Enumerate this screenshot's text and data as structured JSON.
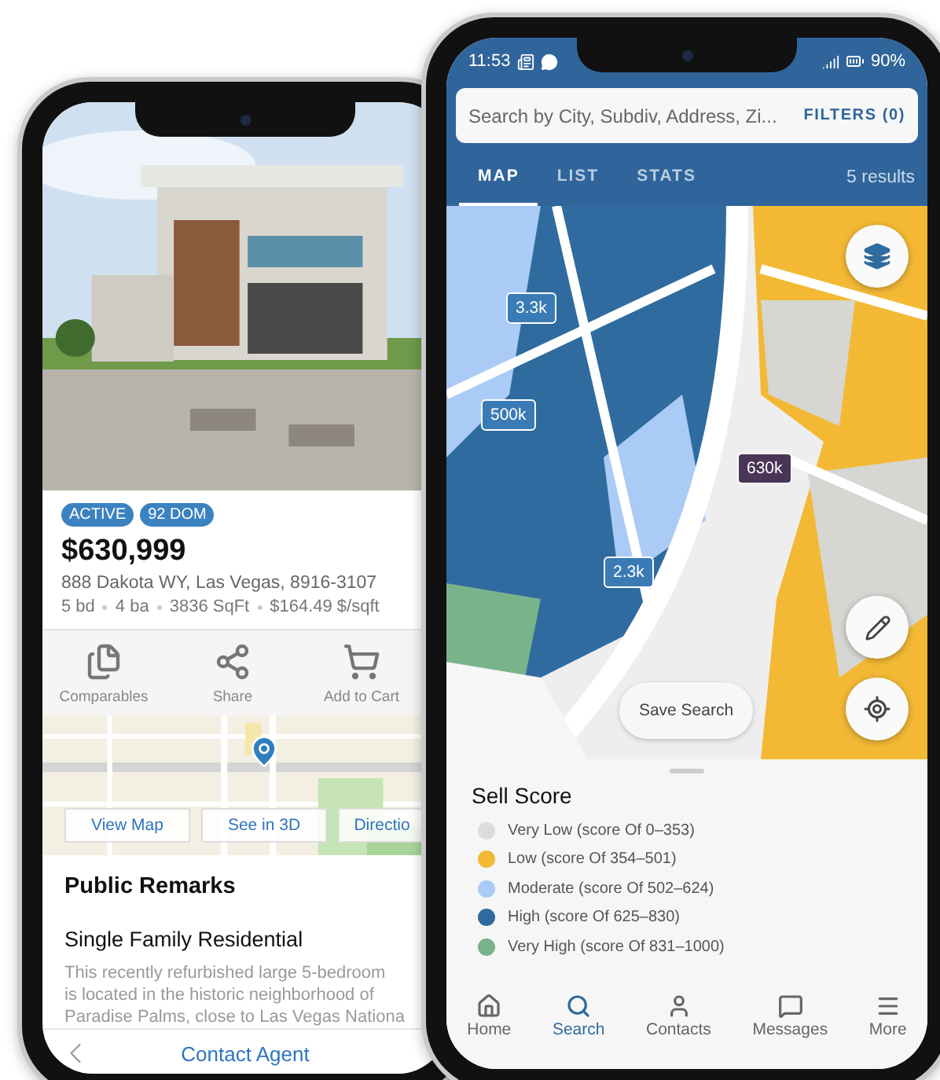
{
  "listing_phone": {
    "badges": [
      "ACTIVE",
      "92 DOM"
    ],
    "price": "$630,999",
    "address": "888 Dakota WY, Las Vegas, 8916-3107",
    "facts": [
      "5 bd",
      "4 ba",
      "3836 SqFt",
      "$164.49 $/sqft"
    ],
    "actions": [
      {
        "label": "Comparables",
        "kind": "compare"
      },
      {
        "label": "Share",
        "kind": "share"
      },
      {
        "label": "Add to Cart",
        "kind": "cart"
      }
    ],
    "map_buttons": [
      "View Map",
      "See in 3D",
      "Directio"
    ],
    "remarks_title": "Public Remarks",
    "property_type": "Single Family Residential",
    "remarks_lines": [
      "This recently refurbished large 5-bedroom",
      "is located in the historic neighborhood of",
      "Paradise Palms, close to Las Vegas Nationa"
    ],
    "contact_button": "Contact Agent"
  },
  "search_phone": {
    "status_bar": {
      "time": "11:53",
      "battery": "90%"
    },
    "search": {
      "placeholder": "Search by City, Subdiv, Address, Zi...",
      "filters": "FILTERS (0)"
    },
    "tabs": [
      {
        "label": "MAP",
        "selected": true
      },
      {
        "label": "LIST",
        "selected": false
      },
      {
        "label": "STATS",
        "selected": false
      }
    ],
    "results": "5 results",
    "price_pins": [
      {
        "label": "3.3k",
        "selected": false
      },
      {
        "label": "500k",
        "selected": false
      },
      {
        "label": "630k",
        "selected": true
      },
      {
        "label": "2.3k",
        "selected": false
      }
    ],
    "save_search": "Save Search",
    "legend": {
      "title": "Sell Score",
      "items": [
        {
          "label": "Very Low (score Of 0–353)",
          "color": "#dcdcdc"
        },
        {
          "label": "Low (score Of 354–501)",
          "color": "#f3b935"
        },
        {
          "label": "Moderate (score Of 502–624)",
          "color": "#a9cbf5"
        },
        {
          "label": "High (score Of 625–830)",
          "color": "#2f6b9e"
        },
        {
          "label": "Very High (score Of 831–1000)",
          "color": "#78b38a"
        }
      ]
    },
    "nav": [
      {
        "label": "Home",
        "kind": "home",
        "selected": false
      },
      {
        "label": "Search",
        "kind": "search",
        "selected": true
      },
      {
        "label": "Contacts",
        "kind": "contacts",
        "selected": false
      },
      {
        "label": "Messages",
        "kind": "messages",
        "selected": false
      },
      {
        "label": "More",
        "kind": "more",
        "selected": false
      }
    ]
  }
}
